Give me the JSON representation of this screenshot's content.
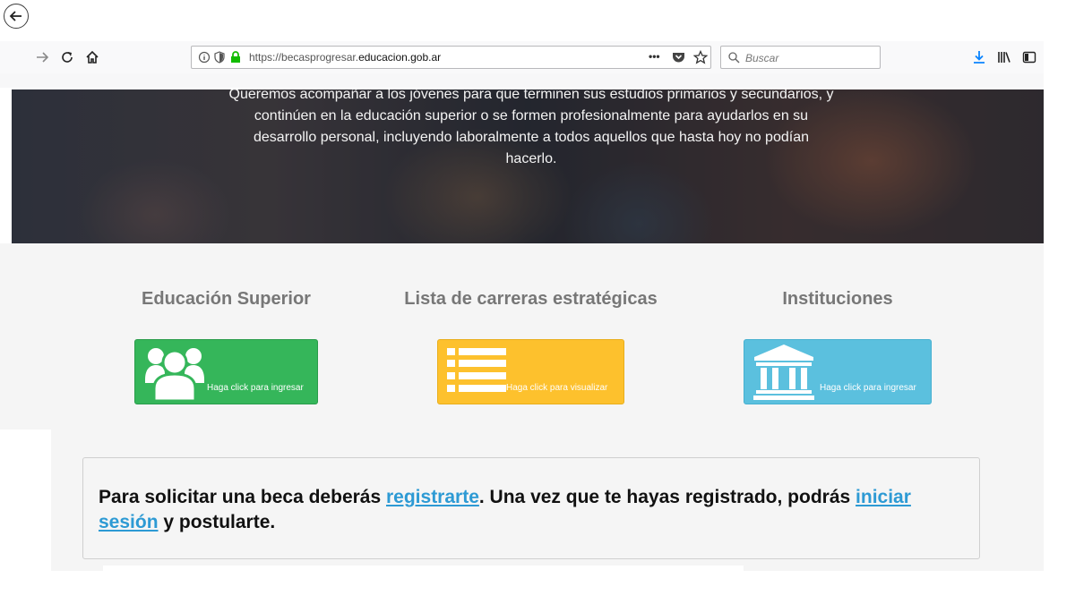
{
  "browser": {
    "url_prefix": "https://becasprogresar.",
    "url_host": "educacion.gob.ar",
    "more_icon": "•••",
    "search_placeholder": "Buscar"
  },
  "hero": {
    "text": "Queremos acompañar a los jóvenes para que terminen sus estudios primarios y secundarios, y continúen en la educación superior o se formen profesionalmente para ayudarlos en su desarrollo personal, incluyendo laboralmente a todos aquellos que hasta hoy no podían hacerlo."
  },
  "cards": {
    "superior": {
      "title": "Educación Superior",
      "label": "Haga click para ingresar",
      "color": "#35b65a",
      "icon": "users-icon"
    },
    "carreras": {
      "title": "Lista de carreras estratégicas",
      "label": "Haga click para visualizar",
      "color": "#fdc12d",
      "icon": "list-icon"
    },
    "instituciones": {
      "title": "Instituciones",
      "label": "Haga click para ingresar",
      "color": "#5bc0de",
      "icon": "institution-icon"
    }
  },
  "info": {
    "part1": "Para solicitar una beca deberás ",
    "link_register": "registrarte",
    "part2": ". Una vez que te hayas registrado, podrás ",
    "link_login": "iniciar sesión",
    "part3": " y postularte."
  }
}
